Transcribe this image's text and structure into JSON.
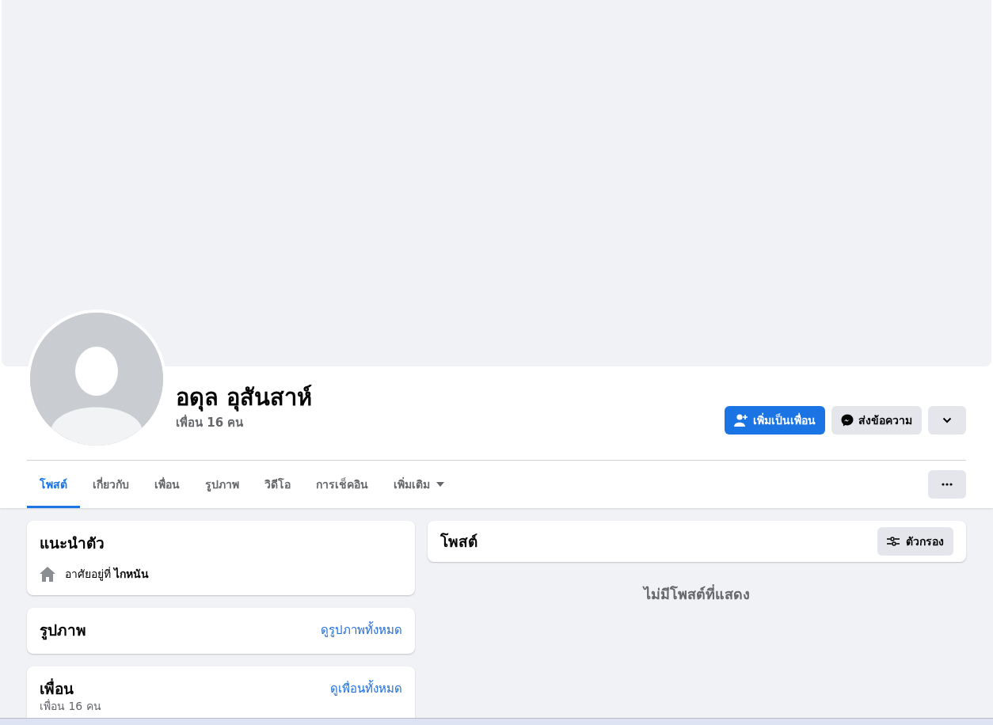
{
  "profile": {
    "name": "อดุล อุสันสาห์",
    "friends_count": "เพื่อน 16 คน"
  },
  "actions": [
    {
      "kind": "primary",
      "label": "เพิ่มเป็นเพื่อน"
    },
    {
      "kind": "secondary",
      "label": "ส่งข้อความ"
    },
    {
      "kind": "icon"
    }
  ],
  "tabs": [
    {
      "label": "โพสต์",
      "selected": true,
      "kind": "tab"
    },
    {
      "label": "เกี่ยวกับ",
      "selected": false,
      "kind": "tab"
    },
    {
      "label": "เพื่อน",
      "selected": false,
      "kind": "tab"
    },
    {
      "label": "รูปภาพ",
      "selected": false,
      "kind": "tab"
    },
    {
      "label": "วิดีโอ",
      "selected": false,
      "kind": "tab"
    },
    {
      "label": "การเช็คอิน",
      "selected": false,
      "kind": "tab"
    },
    {
      "label": "เพิ่มเติม",
      "selected": false,
      "kind": "menu"
    }
  ],
  "intro": {
    "title": "แนะนำตัว",
    "items": [
      {
        "kind": "lives_in",
        "text": "อาศัยอยู่ที่ **ไกหนัน**"
      }
    ]
  },
  "photos": {
    "title": "รูปภาพ",
    "link": "ดูรูปภาพทั้งหมด"
  },
  "friends": {
    "title": "เพื่อน",
    "link": "ดูเพื่อนทั้งหมด",
    "subtitle": "เพื่อน 16 คน"
  },
  "posts": {
    "title": "โพสต์",
    "filter_button": "ตัวกรอง",
    "empty_message": "ไม่มีโพสต์ที่แสดง"
  }
}
